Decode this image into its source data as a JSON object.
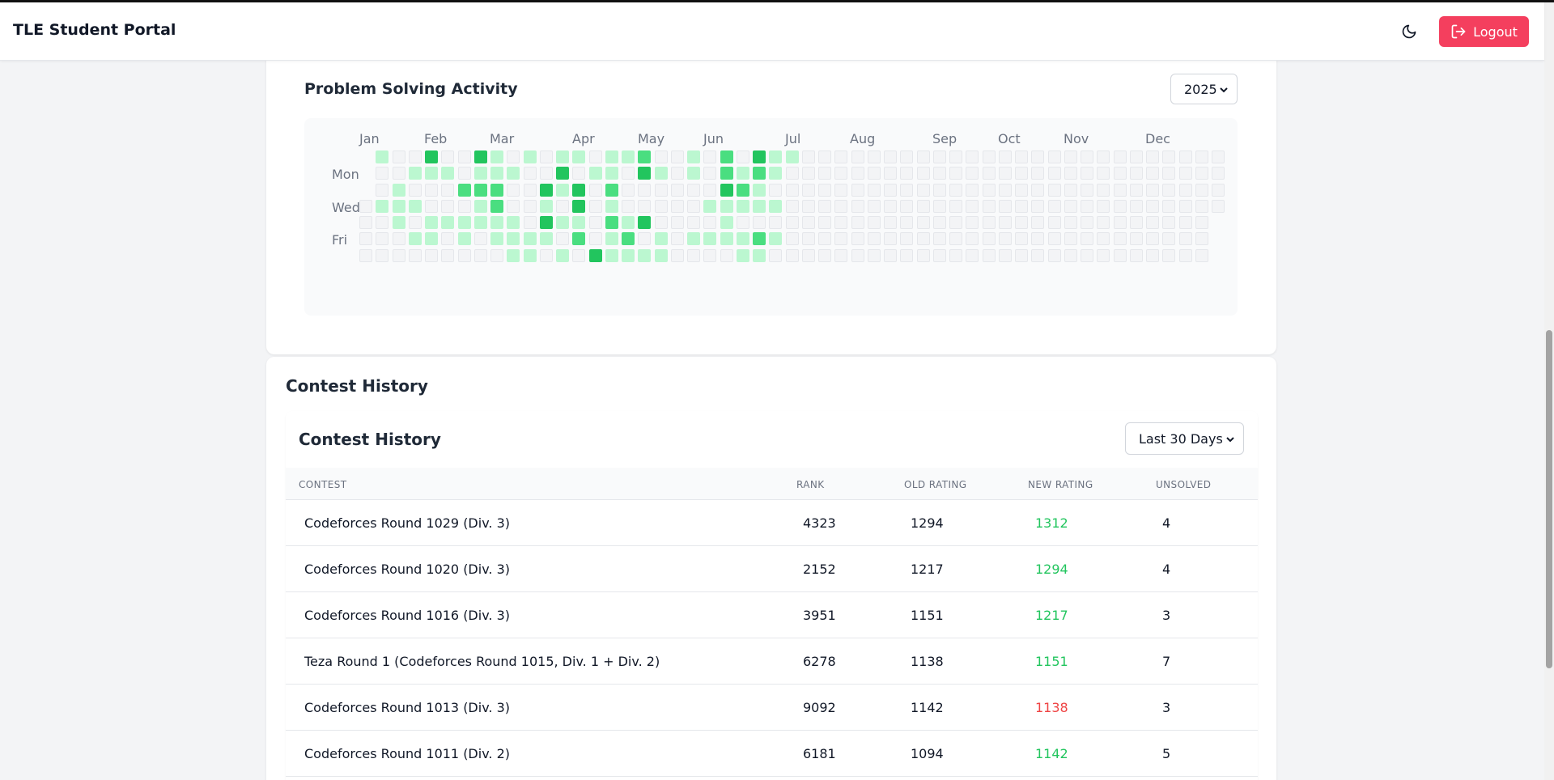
{
  "app": {
    "title": "TLE Student Portal"
  },
  "header": {
    "theme_icon": "moon-icon",
    "logout_label": "Logout",
    "logout_icon": "log-out-icon",
    "accent": "#f43f5e"
  },
  "activity": {
    "title": "Problem Solving Activity",
    "year": "2025",
    "months": [
      "Jan",
      "Feb",
      "Mar",
      "Apr",
      "May",
      "Jun",
      "Jul",
      "Aug",
      "Sep",
      "Oct",
      "Nov",
      "Dec"
    ],
    "day_labels": [
      "Mon",
      "Wed",
      "Fri"
    ],
    "colors": {
      "empty": "#f3f4f6",
      "level1": "#bbf7d0",
      "level2": "#4ade80",
      "level3": "#22c55e"
    },
    "weeks": [
      [
        null,
        null,
        null,
        0,
        0,
        0,
        0
      ],
      [
        1,
        0,
        0,
        1,
        0,
        0,
        0
      ],
      [
        0,
        0,
        1,
        1,
        1,
        0,
        0
      ],
      [
        0,
        1,
        0,
        1,
        0,
        1,
        0
      ],
      [
        3,
        1,
        0,
        0,
        1,
        1,
        0
      ],
      [
        0,
        1,
        0,
        0,
        1,
        0,
        0
      ],
      [
        0,
        0,
        2,
        0,
        1,
        1,
        0
      ],
      [
        3,
        1,
        2,
        1,
        1,
        0,
        0
      ],
      [
        1,
        1,
        2,
        2,
        1,
        1,
        0
      ],
      [
        0,
        1,
        0,
        0,
        1,
        1,
        1
      ],
      [
        1,
        0,
        0,
        0,
        0,
        1,
        1
      ],
      [
        0,
        0,
        3,
        1,
        3,
        1,
        0
      ],
      [
        1,
        3,
        1,
        0,
        1,
        0,
        1
      ],
      [
        1,
        0,
        3,
        3,
        1,
        2,
        0
      ],
      [
        0,
        1,
        0,
        0,
        0,
        0,
        3
      ],
      [
        1,
        1,
        2,
        1,
        2,
        1,
        1
      ],
      [
        1,
        0,
        0,
        0,
        1,
        2,
        1
      ],
      [
        2,
        3,
        0,
        0,
        3,
        0,
        1
      ],
      [
        0,
        1,
        0,
        0,
        0,
        1,
        1
      ],
      [
        0,
        0,
        0,
        0,
        0,
        0,
        0
      ],
      [
        1,
        1,
        0,
        0,
        0,
        1,
        0
      ],
      [
        0,
        0,
        0,
        1,
        0,
        1,
        0
      ],
      [
        2,
        2,
        3,
        1,
        1,
        1,
        0
      ],
      [
        0,
        1,
        2,
        1,
        0,
        1,
        1
      ],
      [
        3,
        2,
        1,
        1,
        0,
        2,
        1
      ],
      [
        1,
        1,
        0,
        1,
        0,
        1,
        0
      ],
      [
        1,
        0,
        0,
        0,
        0,
        0,
        0
      ],
      [
        0,
        0,
        0,
        0,
        0,
        0,
        0
      ],
      [
        0,
        0,
        0,
        0,
        0,
        0,
        0
      ],
      [
        0,
        0,
        0,
        0,
        0,
        0,
        0
      ],
      [
        0,
        0,
        0,
        0,
        0,
        0,
        0
      ],
      [
        0,
        0,
        0,
        0,
        0,
        0,
        0
      ],
      [
        0,
        0,
        0,
        0,
        0,
        0,
        0
      ],
      [
        0,
        0,
        0,
        0,
        0,
        0,
        0
      ],
      [
        0,
        0,
        0,
        0,
        0,
        0,
        0
      ],
      [
        0,
        0,
        0,
        0,
        0,
        0,
        0
      ],
      [
        0,
        0,
        0,
        0,
        0,
        0,
        0
      ],
      [
        0,
        0,
        0,
        0,
        0,
        0,
        0
      ],
      [
        0,
        0,
        0,
        0,
        0,
        0,
        0
      ],
      [
        0,
        0,
        0,
        0,
        0,
        0,
        0
      ],
      [
        0,
        0,
        0,
        0,
        0,
        0,
        0
      ],
      [
        0,
        0,
        0,
        0,
        0,
        0,
        0
      ],
      [
        0,
        0,
        0,
        0,
        0,
        0,
        0
      ],
      [
        0,
        0,
        0,
        0,
        0,
        0,
        0
      ],
      [
        0,
        0,
        0,
        0,
        0,
        0,
        0
      ],
      [
        0,
        0,
        0,
        0,
        0,
        0,
        0
      ],
      [
        0,
        0,
        0,
        0,
        0,
        0,
        0
      ],
      [
        0,
        0,
        0,
        0,
        0,
        0,
        0
      ],
      [
        0,
        0,
        0,
        0,
        0,
        0,
        0
      ],
      [
        0,
        0,
        0,
        0,
        0,
        0,
        0
      ],
      [
        0,
        0,
        0,
        0,
        0,
        0,
        0
      ],
      [
        0,
        0,
        0,
        0,
        0,
        0,
        0
      ],
      [
        0,
        0,
        0,
        0,
        null,
        null,
        null
      ]
    ]
  },
  "contests": {
    "section_title": "Contest History",
    "table_title": "Contest History",
    "range": "Last 30 Days",
    "columns": [
      "CONTEST",
      "RANK",
      "OLD RATING",
      "NEW RATING",
      "UNSOLVED"
    ],
    "rows": [
      {
        "name": "Codeforces Round 1029 (Div. 3)",
        "rank": "4323",
        "old": "1294",
        "new": "1312",
        "change": "up",
        "unsolved": "4"
      },
      {
        "name": "Codeforces Round 1020 (Div. 3)",
        "rank": "2152",
        "old": "1217",
        "new": "1294",
        "change": "up",
        "unsolved": "4"
      },
      {
        "name": "Codeforces Round 1016 (Div. 3)",
        "rank": "3951",
        "old": "1151",
        "new": "1217",
        "change": "up",
        "unsolved": "3"
      },
      {
        "name": "Teza Round 1 (Codeforces Round 1015, Div. 1 + Div. 2)",
        "rank": "6278",
        "old": "1138",
        "new": "1151",
        "change": "up",
        "unsolved": "7"
      },
      {
        "name": "Codeforces Round 1013 (Div. 3)",
        "rank": "9092",
        "old": "1142",
        "new": "1138",
        "change": "down",
        "unsolved": "3"
      },
      {
        "name": "Codeforces Round 1011 (Div. 2)",
        "rank": "6181",
        "old": "1094",
        "new": "1142",
        "change": "up",
        "unsolved": "5"
      }
    ]
  }
}
